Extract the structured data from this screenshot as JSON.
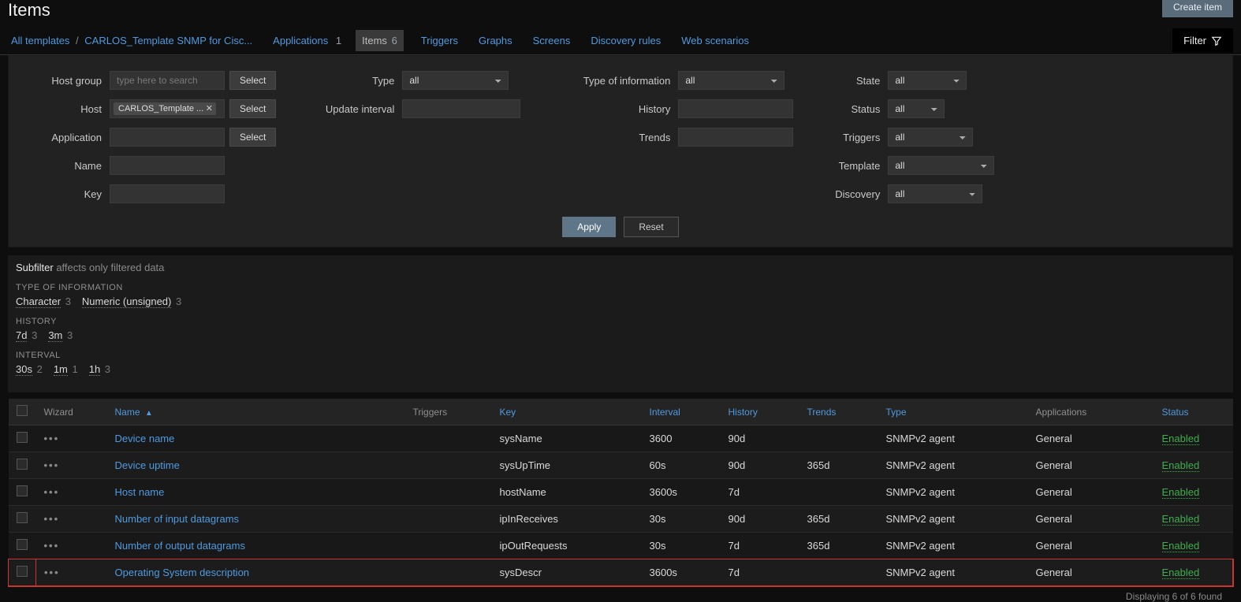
{
  "header": {
    "title": "Items",
    "create_button": "Create item"
  },
  "breadcrumb": {
    "all_templates": "All templates",
    "template": "CARLOS_Template SNMP for Cisc..."
  },
  "tabs": {
    "applications": {
      "label": "Applications",
      "count": "1"
    },
    "items": {
      "label": "Items",
      "count": "6"
    },
    "triggers": {
      "label": "Triggers"
    },
    "graphs": {
      "label": "Graphs"
    },
    "screens": {
      "label": "Screens"
    },
    "discovery": {
      "label": "Discovery rules"
    },
    "web": {
      "label": "Web scenarios"
    }
  },
  "filter_toggle": "Filter",
  "filter": {
    "labels": {
      "host_group": "Host group",
      "host": "Host",
      "application": "Application",
      "name": "Name",
      "key": "Key",
      "type": "Type",
      "update_interval": "Update interval",
      "type_of_information": "Type of information",
      "history": "History",
      "trends": "Trends",
      "state": "State",
      "status": "Status",
      "triggers": "Triggers",
      "template": "Template",
      "discovery": "Discovery"
    },
    "placeholders": {
      "host_group": "type here to search"
    },
    "host_chip": "CARLOS_Template ...",
    "select_btn": "Select",
    "type_value": "all",
    "state_value": "all",
    "status_value": "all",
    "triggers_value": "all",
    "template_value": "all",
    "discovery_value": "all",
    "apply": "Apply",
    "reset": "Reset"
  },
  "subfilter": {
    "title": "Subfilter",
    "note": "affects only filtered data",
    "groups": [
      {
        "title": "TYPE OF INFORMATION",
        "items": [
          {
            "label": "Character",
            "count": "3"
          },
          {
            "label": "Numeric (unsigned)",
            "count": "3"
          }
        ]
      },
      {
        "title": "HISTORY",
        "items": [
          {
            "label": "7d",
            "count": "3"
          },
          {
            "label": "3m",
            "count": "3"
          }
        ]
      },
      {
        "title": "INTERVAL",
        "items": [
          {
            "label": "30s",
            "count": "2"
          },
          {
            "label": "1m",
            "count": "1"
          },
          {
            "label": "1h",
            "count": "3"
          }
        ]
      }
    ]
  },
  "table": {
    "headers": {
      "wizard": "Wizard",
      "name": "Name",
      "triggers": "Triggers",
      "key": "Key",
      "interval": "Interval",
      "history": "History",
      "trends": "Trends",
      "type": "Type",
      "applications": "Applications",
      "status": "Status"
    },
    "rows": [
      {
        "name": "Device name",
        "key": "sysName",
        "interval": "3600",
        "history": "90d",
        "trends": "",
        "type": "SNMPv2 agent",
        "applications": "General",
        "status": "Enabled"
      },
      {
        "name": "Device uptime",
        "key": "sysUpTime",
        "interval": "60s",
        "history": "90d",
        "trends": "365d",
        "type": "SNMPv2 agent",
        "applications": "General",
        "status": "Enabled"
      },
      {
        "name": "Host name",
        "key": "hostName",
        "interval": "3600s",
        "history": "7d",
        "trends": "",
        "type": "SNMPv2 agent",
        "applications": "General",
        "status": "Enabled"
      },
      {
        "name": "Number of input datagrams",
        "key": "ipInReceives",
        "interval": "30s",
        "history": "90d",
        "trends": "365d",
        "type": "SNMPv2 agent",
        "applications": "General",
        "status": "Enabled"
      },
      {
        "name": "Number of output datagrams",
        "key": "ipOutRequests",
        "interval": "30s",
        "history": "7d",
        "trends": "365d",
        "type": "SNMPv2 agent",
        "applications": "General",
        "status": "Enabled"
      },
      {
        "name": "Operating System description",
        "key": "sysDescr",
        "interval": "3600s",
        "history": "7d",
        "trends": "",
        "type": "SNMPv2 agent",
        "applications": "General",
        "status": "Enabled",
        "highlight": true
      }
    ],
    "sort_arrow": "▲"
  },
  "footer": {
    "count": "Displaying 6 of 6 found"
  }
}
